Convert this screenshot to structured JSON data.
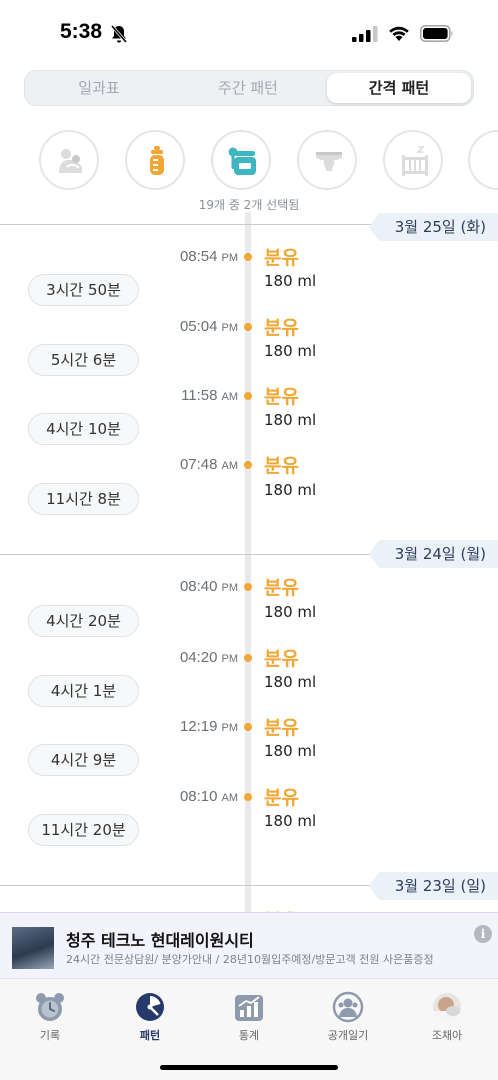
{
  "status_bar": {
    "time": "5:38"
  },
  "segments": [
    {
      "label": "일과표"
    },
    {
      "label": "주간 패턴"
    },
    {
      "label": "간격 패턴"
    }
  ],
  "categories": [
    {
      "icon": "baby-sleep-icon"
    },
    {
      "icon": "baby-bottle-icon"
    },
    {
      "icon": "food-jar-icon"
    },
    {
      "icon": "diaper-icon"
    },
    {
      "icon": "crib-icon"
    }
  ],
  "selected_count": "19개 중 2개 선택됨",
  "days": [
    {
      "date": "3월 25일 (화)",
      "events": [
        {
          "time": "08:54",
          "ampm": "PM",
          "title": "분유",
          "amount": "180 ml"
        },
        {
          "time": "05:04",
          "ampm": "PM",
          "title": "분유",
          "amount": "180 ml"
        },
        {
          "time": "11:58",
          "ampm": "AM",
          "title": "분유",
          "amount": "180 ml"
        },
        {
          "time": "07:48",
          "ampm": "AM",
          "title": "분유",
          "amount": "180 ml"
        }
      ],
      "gaps": [
        "3시간 50분",
        "5시간 6분",
        "4시간 10분",
        "11시간 8분"
      ]
    },
    {
      "date": "3월 24일 (월)",
      "events": [
        {
          "time": "08:40",
          "ampm": "PM",
          "title": "분유",
          "amount": "180 ml"
        },
        {
          "time": "04:20",
          "ampm": "PM",
          "title": "분유",
          "amount": "180 ml"
        },
        {
          "time": "12:19",
          "ampm": "PM",
          "title": "분유",
          "amount": "180 ml"
        },
        {
          "time": "08:10",
          "ampm": "AM",
          "title": "분유",
          "amount": "180 ml"
        }
      ],
      "gaps": [
        "4시간 20분",
        "4시간 1분",
        "4시간 9분",
        "11시간 20분"
      ]
    },
    {
      "date": "3월 23일 (일)",
      "events": [
        {
          "time": "",
          "ampm": "",
          "title": "분유",
          "amount": ""
        }
      ]
    }
  ],
  "ad": {
    "title": "청주 테크노 현대레이원시티",
    "description": "24시간 전문상담원/ 분양가안내 / 28년10월입주예정/방문고객 전원 사은품증정",
    "info": "i"
  },
  "tabs": [
    {
      "label": "기록",
      "icon": "alarm-clock-icon"
    },
    {
      "label": "패턴",
      "icon": "pattern-chart-icon",
      "active": true
    },
    {
      "label": "통계",
      "icon": "statistics-icon"
    },
    {
      "label": "공개일기",
      "icon": "public-diary-icon"
    },
    {
      "label": "조채아",
      "icon": "baby-avatar-icon"
    }
  ],
  "colors": {
    "accent": "#f2a735",
    "date_tag_bg": "#eaf1f8",
    "tab_active": "#253a6b"
  }
}
